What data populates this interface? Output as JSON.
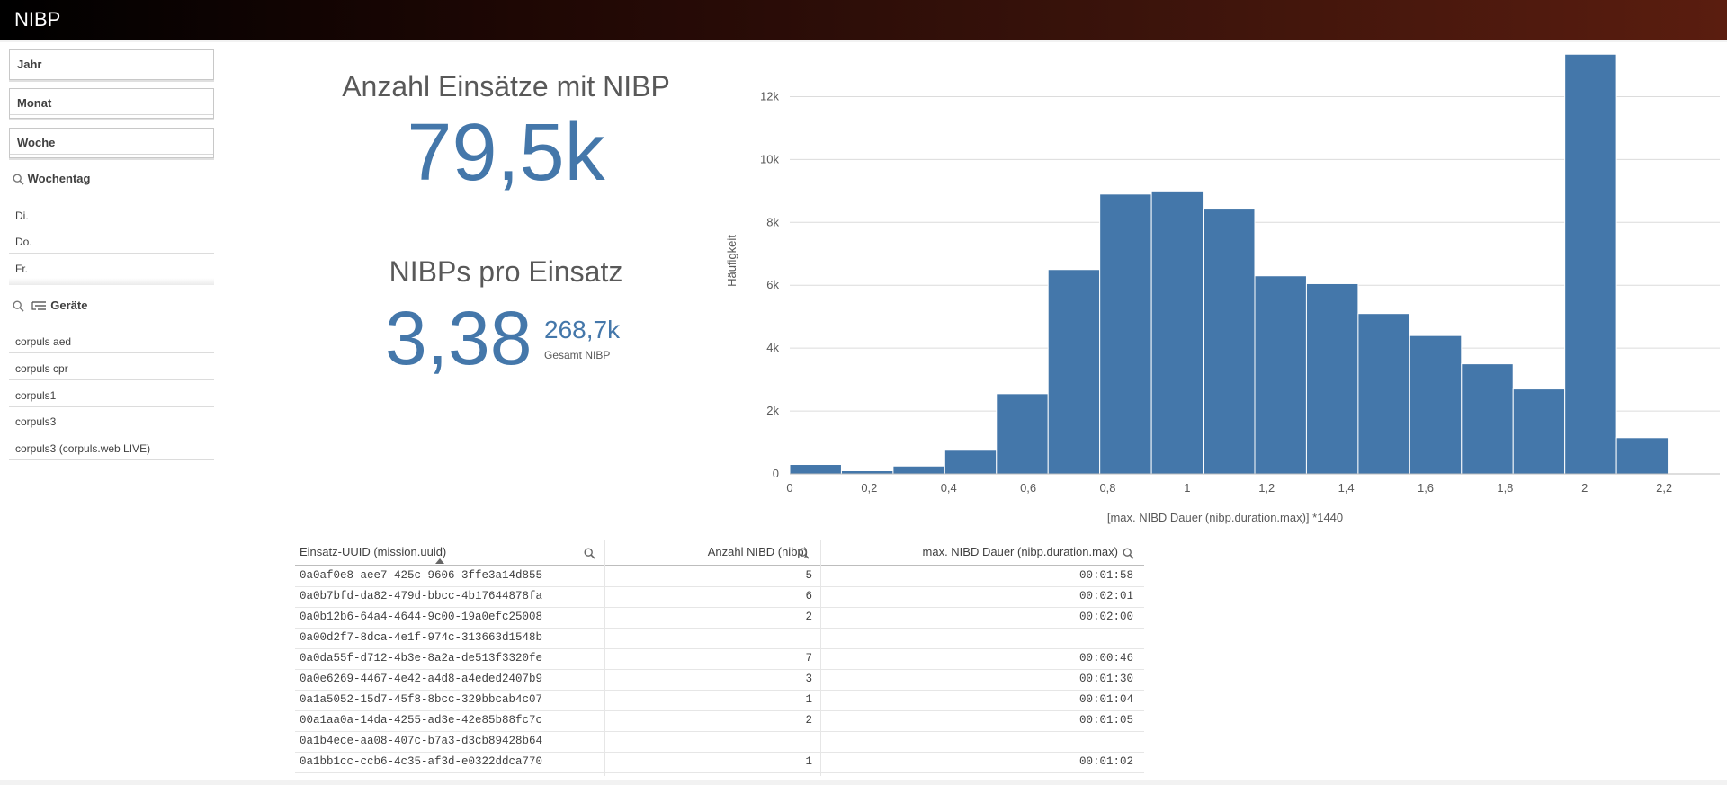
{
  "app": {
    "title": "NIBP"
  },
  "filters": {
    "boxes": [
      {
        "label": "Jahr"
      },
      {
        "label": "Monat"
      },
      {
        "label": "Woche"
      }
    ],
    "wochentag": {
      "title": "Wochentag",
      "items": [
        "Di.",
        "Do.",
        "Fr."
      ]
    },
    "geraete": {
      "title": "Geräte",
      "items": [
        "corpuls aed",
        "corpuls cpr",
        "corpuls1",
        "corpuls3",
        "corpuls3 (corpuls.web LIVE)"
      ]
    }
  },
  "kpi": {
    "einsaetze_title": "Anzahl Einsätze mit NIBP",
    "einsaetze_value": "79,5k",
    "pro_einsatz_title": "NIBPs pro Einsatz",
    "pro_einsatz_value": "3,38",
    "gesamt_value": "268,7k",
    "gesamt_label": "Gesamt NIBP"
  },
  "chart_data": {
    "type": "bar",
    "xlabel": "[max. NIBD Dauer (nibp.duration.max)] *1440",
    "ylabel": "Häufigkeit",
    "x_ticks": [
      "0",
      "0,2",
      "0,4",
      "0,6",
      "0,8",
      "1",
      "1,2",
      "1,4",
      "1,6",
      "1,8",
      "2",
      "2,2"
    ],
    "x_tick_values": [
      0,
      0.2,
      0.4,
      0.6,
      0.8,
      1.0,
      1.2,
      1.4,
      1.6,
      1.8,
      2.0,
      2.2
    ],
    "y_ticks": [
      "0",
      "2k",
      "4k",
      "6k",
      "8k",
      "10k",
      "12k"
    ],
    "y_tick_values": [
      0,
      2000,
      4000,
      6000,
      8000,
      10000,
      12000
    ],
    "xlim": [
      0,
      2.34
    ],
    "ylim": [
      0,
      13500
    ],
    "bin_width": 0.13,
    "bin_starts": [
      0,
      0.13,
      0.26,
      0.39,
      0.52,
      0.65,
      0.78,
      0.91,
      1.04,
      1.17,
      1.3,
      1.43,
      1.56,
      1.69,
      1.82,
      1.95,
      2.08
    ],
    "values": [
      300,
      100,
      250,
      750,
      2550,
      6500,
      8900,
      9000,
      8450,
      6300,
      6050,
      5100,
      4400,
      3500,
      2700,
      13350,
      1150
    ],
    "bar_color": "#4477aa",
    "grid": true
  },
  "table": {
    "headers": [
      "Einsatz-UUID (mission.uuid)",
      "Anzahl NIBD (nibp)",
      "max. NIBD Dauer (nibp.duration.max)"
    ],
    "rows": [
      [
        "0a0af0e8-aee7-425c-9606-3ffe3a14d855",
        "5",
        "00:01:58"
      ],
      [
        "0a0b7bfd-da82-479d-bbcc-4b17644878fa",
        "6",
        "00:02:01"
      ],
      [
        "0a0b12b6-64a4-4644-9c00-19a0efc25008",
        "2",
        "00:02:00"
      ],
      [
        "0a00d2f7-8dca-4e1f-974c-313663d1548b",
        "",
        ""
      ],
      [
        "0a0da55f-d712-4b3e-8a2a-de513f3320fe",
        "7",
        "00:00:46"
      ],
      [
        "0a0e6269-4467-4e42-a4d8-a4eded2407b9",
        "3",
        "00:01:30"
      ],
      [
        "0a1a5052-15d7-45f8-8bcc-329bbcab4c07",
        "1",
        "00:01:04"
      ],
      [
        "00a1aa0a-14da-4255-ad3e-42e85b88fc7c",
        "2",
        "00:01:05"
      ],
      [
        "0a1b4ece-aa08-407c-b7a3-d3cb89428b64",
        "",
        ""
      ],
      [
        "0a1bb1cc-ccb6-4c35-af3d-e0322ddca770",
        "1",
        "00:01:02"
      ]
    ]
  }
}
